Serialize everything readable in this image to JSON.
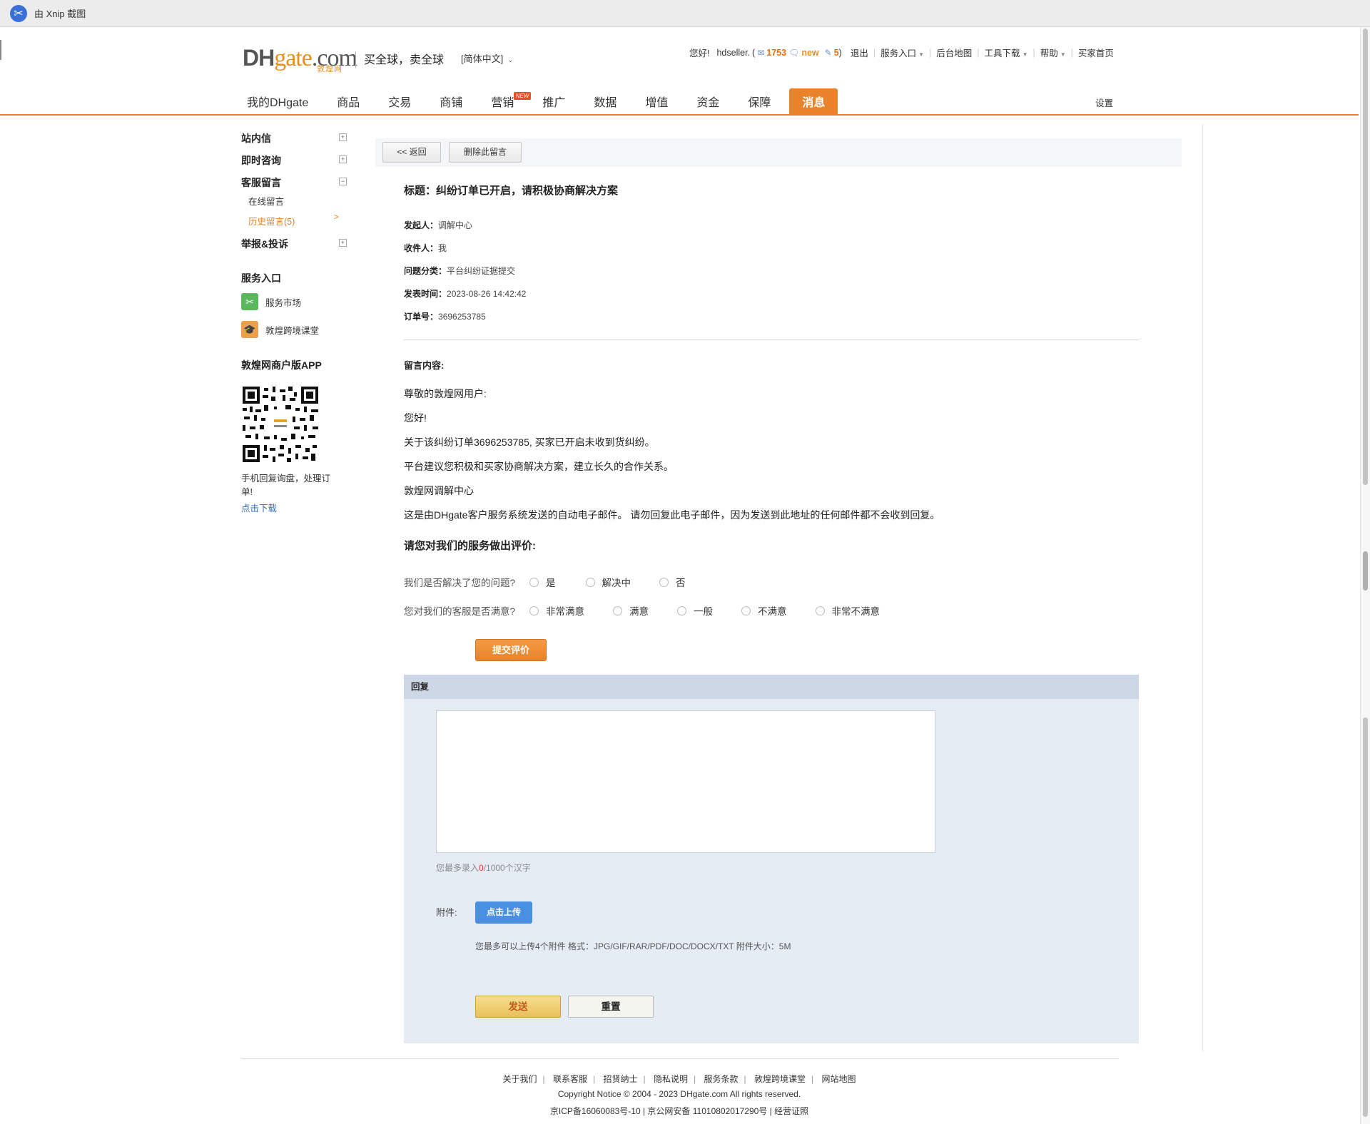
{
  "app": {
    "title": "由 Xnip 截图"
  },
  "header": {
    "logo_dh": "DH",
    "logo_gate": "gate",
    "logo_com": ".com",
    "logo_sub": "敦煌网",
    "slogan": "买全球，卖全球",
    "language": "[简体中文]",
    "greeting": "您好!",
    "username": "hdseller.",
    "open_paren": "(",
    "mail_count": "1753",
    "new_label": "new",
    "notice_count": "5",
    "close_paren": ")",
    "logout": "退出",
    "service_entry": "服务入口",
    "sitemap": "后台地图",
    "tools": "工具下载",
    "help": "帮助",
    "buyer_home": "买家首页"
  },
  "mainnav": {
    "items": [
      {
        "label": "我的DHgate"
      },
      {
        "label": "商品"
      },
      {
        "label": "交易"
      },
      {
        "label": "商铺"
      },
      {
        "label": "营销",
        "badge": "NEW"
      },
      {
        "label": "推广"
      },
      {
        "label": "数据"
      },
      {
        "label": "增值"
      },
      {
        "label": "资金"
      },
      {
        "label": "保障"
      },
      {
        "label": "消息"
      }
    ],
    "active": "消息",
    "settings": "设置"
  },
  "sidebar": {
    "groups": [
      {
        "label": "站内信",
        "toggle": "+"
      },
      {
        "label": "即时咨询",
        "toggle": "+"
      },
      {
        "label": "客服留言",
        "toggle": "−"
      },
      {
        "label": "举报&投诉",
        "toggle": "+"
      }
    ],
    "sub_items": [
      {
        "label": "在线留言"
      },
      {
        "label": "历史留言(5)",
        "arrow": ">"
      }
    ],
    "service_heading": "服务入口",
    "services": [
      {
        "label": "服务市场",
        "icon": "tools-icon"
      },
      {
        "label": "敦煌跨境课堂",
        "icon": "graduation-cap-icon"
      }
    ],
    "app_heading": "敦煌网商户版APP",
    "app_note": "手机回复询盘，处理订单!",
    "app_link": "点击下载"
  },
  "toolbar": {
    "back": "<< 返回",
    "delete": "删除此留言"
  },
  "message": {
    "title": "标题：纠纷订单已开启，请积极协商解决方案",
    "meta": [
      {
        "label": "发起人：",
        "value": "调解中心"
      },
      {
        "label": "收件人：",
        "value": "我"
      },
      {
        "label": "问题分类：",
        "value": "平台纠纷证据提交"
      },
      {
        "label": "发表时间：",
        "value": "2023-08-26 14:42:42"
      },
      {
        "label": "订单号：",
        "value": "3696253785"
      }
    ],
    "content_label": "留言内容:",
    "body": [
      "尊敬的敦煌网用户:",
      "您好!",
      "关于该纠纷订单3696253785, 买家已开启未收到货纠纷。",
      "平台建议您积极和买家协商解决方案，建立长久的合作关系。",
      "敦煌网调解中心",
      "这是由DHgate客户服务系统发送的自动电子邮件。 请勿回复此电子邮件，因为发送到此地址的任何邮件都不会收到回复。"
    ]
  },
  "rating": {
    "title": "请您对我们的服务做出评价:",
    "q1": "我们是否解决了您的问题?",
    "q1_options": [
      "是",
      "解决中",
      "否"
    ],
    "q2": "您对我们的客服是否满意?",
    "q2_options": [
      "非常满意",
      "满意",
      "一般",
      "不满意",
      "非常不满意"
    ],
    "submit": "提交评价"
  },
  "reply": {
    "header": "回复",
    "textarea_value": "",
    "counter_prefix": "您最多录入",
    "counter_value": "0",
    "counter_suffix": "/1000个汉字",
    "attach_label": "附件:",
    "upload": "点击上传",
    "attach_note": "您最多可以上传4个附件 格式：JPG/GIF/RAR/PDF/DOC/DOCX/TXT 附件大小：5M",
    "send": "发送",
    "reset": "重置"
  },
  "footer": {
    "links": [
      "关于我们",
      "联系客服",
      "招贤纳士",
      "隐私说明",
      "服务条款",
      "敦煌跨境课堂",
      "网站地图"
    ],
    "copyright": "Copyright Notice © 2004 - 2023 DHgate.com All rights reserved.",
    "icp": "京ICP备16060083号-10 | 京公网安备 11010802017290号 | 经营证照"
  },
  "colors": {
    "accent": "#e8832b",
    "link": "#2f6db5",
    "reply_bg": "#e6ecf4",
    "reply_head": "#cdd7e6",
    "upload_button": "#4a90e2"
  }
}
